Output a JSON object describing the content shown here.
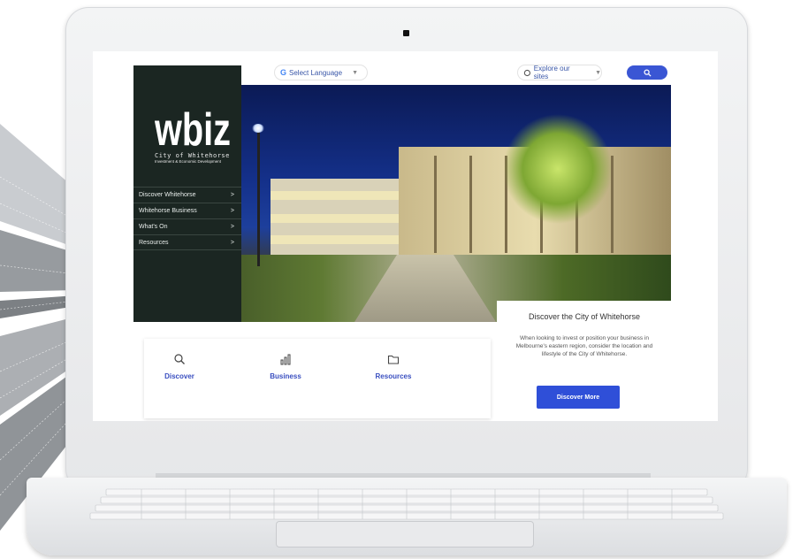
{
  "colors": {
    "accent": "#3a56d4",
    "sidebar": "#1b2622",
    "link": "#3a4fc0",
    "button": "#2f4fd8"
  },
  "topbar": {
    "language_label": "Select Language",
    "language_icon": "google-g-icon",
    "explore_label": "Explore our sites",
    "explore_icon": "globe-icon",
    "search_icon": "search-icon"
  },
  "sidebar": {
    "logo_text": "wbiz",
    "logo_line1": "City of Whitehorse",
    "logo_line2": "Investment & Economic Development",
    "items": [
      {
        "label": "Discover Whitehorse",
        "icon": "chevron-right-icon"
      },
      {
        "label": "Whitehorse Business",
        "icon": "chevron-right-icon"
      },
      {
        "label": "What's On",
        "icon": "chevron-right-icon"
      },
      {
        "label": "Resources",
        "icon": "chevron-right-icon"
      }
    ]
  },
  "quicklinks": [
    {
      "label": "Discover",
      "icon": "search-icon"
    },
    {
      "label": "Business",
      "icon": "bar-chart-icon"
    },
    {
      "label": "Resources",
      "icon": "folder-icon"
    }
  ],
  "card": {
    "title": "Discover the City of Whitehorse",
    "body": "When looking to invest or position your business in Melbourne's eastern region, consider the location and lifestyle of the City of Whitehorse.",
    "button_label": "Discover More"
  }
}
